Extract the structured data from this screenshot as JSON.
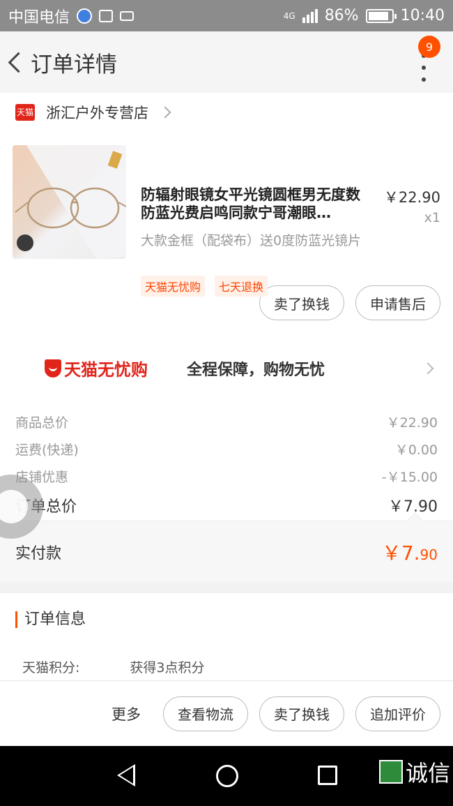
{
  "status_bar": {
    "carrier": "中国电信",
    "network": "4G",
    "battery": "86%",
    "time": "10:40"
  },
  "navbar": {
    "title": "订单详情",
    "badge_count": "9"
  },
  "shop": {
    "logo_text": "天猫",
    "name": "浙汇户外专营店"
  },
  "product": {
    "name": "防辐射眼镜女平光镜圆框男无度数防蓝光费启鸣同款宁哥潮眼…",
    "price": "￥22.90",
    "quantity": "x1",
    "sku": "大款金框（配袋布）送0度防蓝光镜片",
    "tags": [
      "天猫无忧购",
      "七天退换"
    ]
  },
  "item_actions": {
    "sell_label": "卖了换钱",
    "after_sales_label": "申请售后"
  },
  "guarantee": {
    "brand": "天猫无忧购",
    "slogan": "全程保障，购物无忧"
  },
  "costs": [
    {
      "label": "商品总价",
      "value": "￥22.90"
    },
    {
      "label": "运费(快递)",
      "value": "￥0.00"
    },
    {
      "label": "店铺优惠",
      "value": "-￥15.00"
    }
  ],
  "order_total": {
    "label": "订单总价",
    "value": "￥7.90"
  },
  "paid": {
    "label": "实付款",
    "value_main": "￥7.",
    "value_cents": "90"
  },
  "order_info": {
    "title": "订单信息",
    "points_label": "天猫积分:",
    "points_value": "获得3点积分"
  },
  "bottom_actions": {
    "more_label": "更多",
    "logistics_label": "查看物流",
    "sell_label": "卖了换钱",
    "review_label": "追加评价"
  },
  "watermark": {
    "text": "诚信"
  },
  "colors": {
    "accent": "#ff5000",
    "tmall_red": "#e1251b"
  }
}
